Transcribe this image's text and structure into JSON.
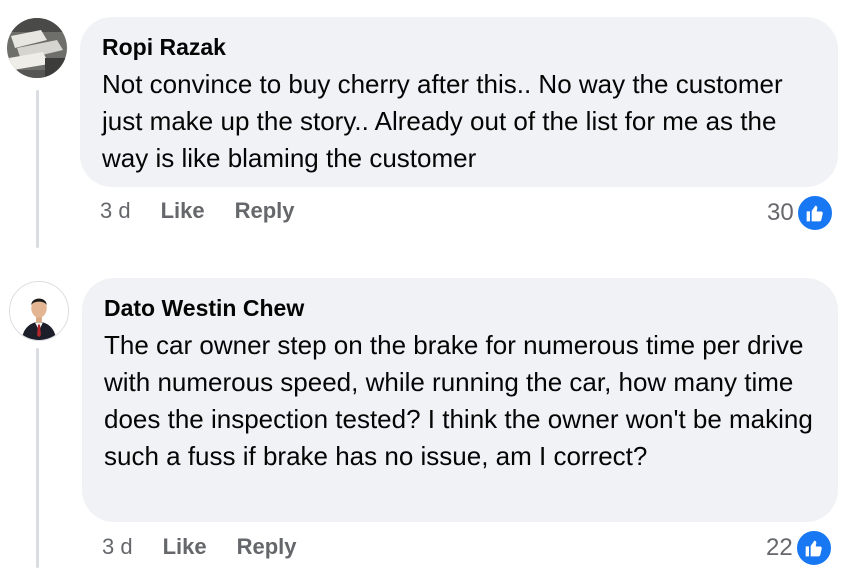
{
  "colors": {
    "bubble_bg": "#f0f2f5",
    "meta_text": "#65676b",
    "like_blue": "#1877f2",
    "thread_line": "#dadde1"
  },
  "comments": [
    {
      "author": "Ropi Razak",
      "text": "Not convince to buy cherry after this.. No way the customer just make up the story.. Already out of the list for me as the way is like blaming the customer",
      "time": "3 d",
      "like_label": "Like",
      "reply_label": "Reply",
      "reaction_count": "30",
      "reaction_icon": "thumbs-up-icon"
    },
    {
      "author": "Dato Westin Chew",
      "text": "The car owner step on the brake for numerous time per drive with numerous speed, while running the car, how many time does the inspection tested? I think the owner won't be making such a fuss if brake has no issue, am I correct?",
      "time": "3 d",
      "like_label": "Like",
      "reply_label": "Reply",
      "reaction_count": "22",
      "reaction_icon": "thumbs-up-icon"
    }
  ]
}
